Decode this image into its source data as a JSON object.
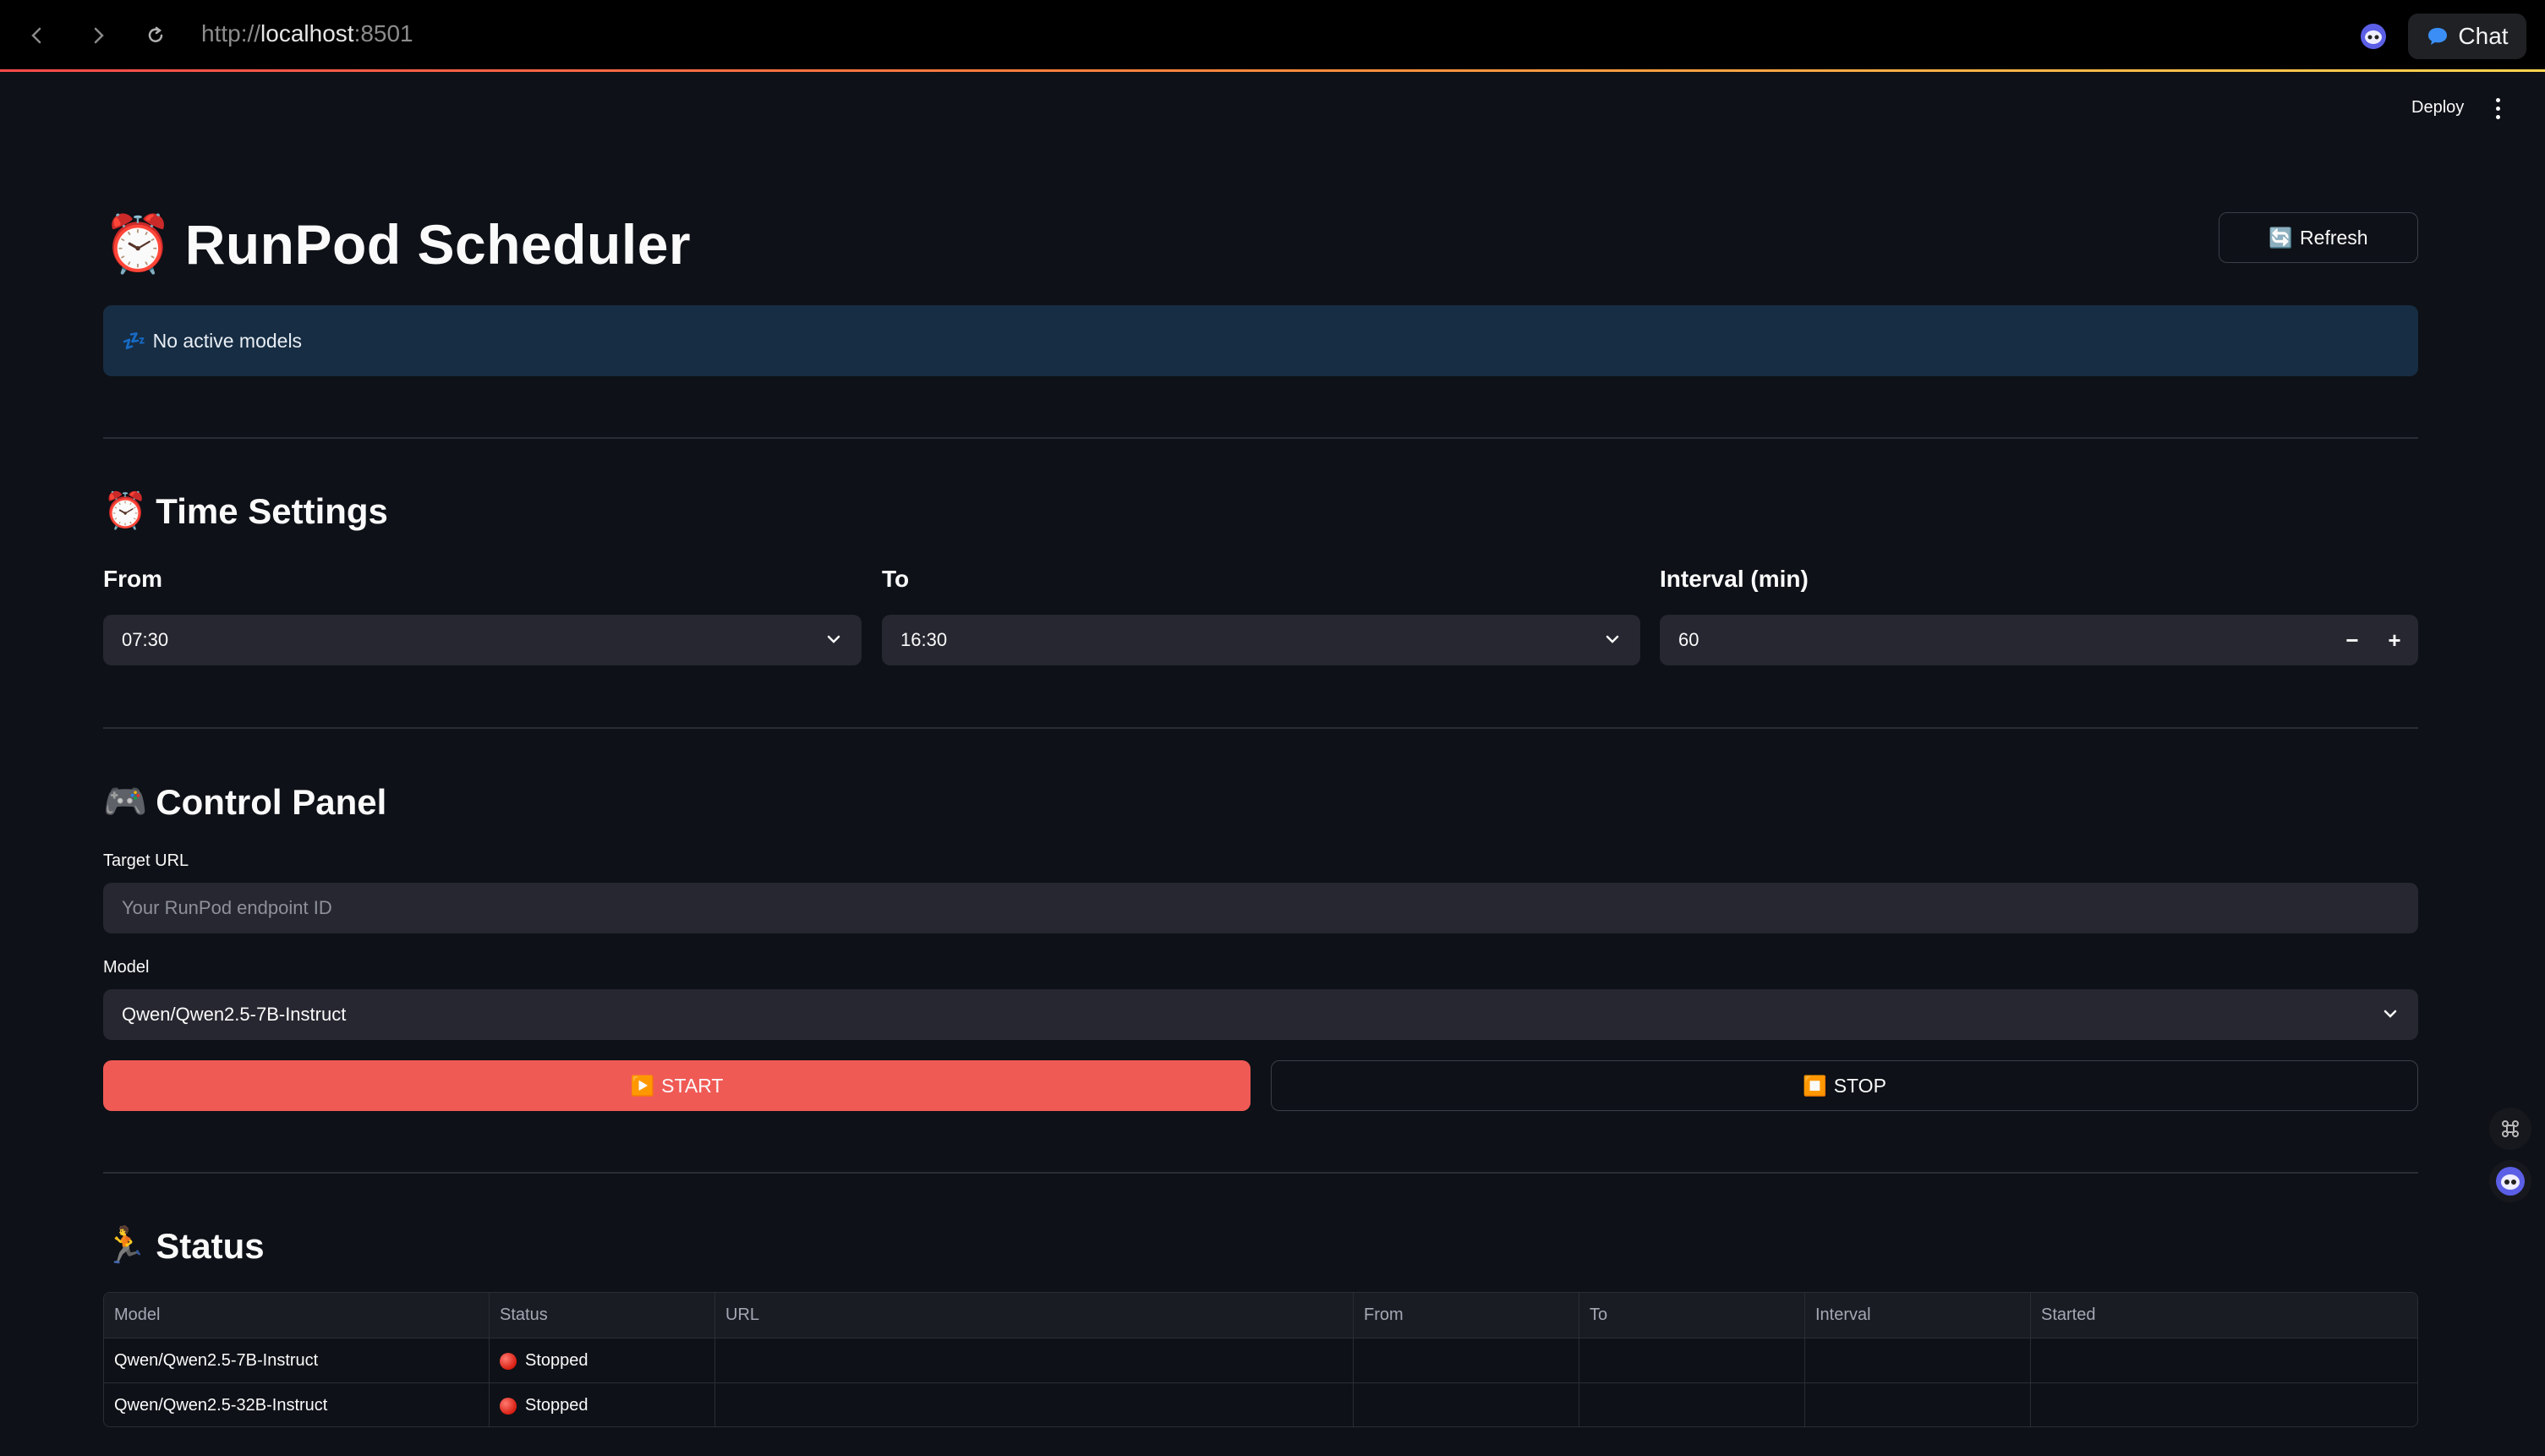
{
  "browser": {
    "url_scheme": "http://",
    "url_host": "localhost",
    "url_port": ":8501",
    "chat_label": "Chat"
  },
  "header": {
    "deploy_label": "Deploy"
  },
  "app": {
    "title": "RunPod Scheduler",
    "title_emoji": "⏰",
    "refresh_label": "Refresh",
    "refresh_emoji": "🔄",
    "info_message": "No active models",
    "info_emoji": "💤"
  },
  "time_settings": {
    "heading": "Time Settings",
    "heading_emoji": "⏰",
    "from_label": "From",
    "from_value": "07:30",
    "to_label": "To",
    "to_value": "16:30",
    "interval_label": "Interval (min)",
    "interval_value": "60",
    "minus": "−",
    "plus": "+"
  },
  "control_panel": {
    "heading": "Control Panel",
    "heading_emoji": "🎮",
    "target_url_label": "Target URL",
    "target_url_placeholder": "Your RunPod endpoint ID",
    "model_label": "Model",
    "model_value": "Qwen/Qwen2.5-7B-Instruct",
    "start_label": "START",
    "start_emoji": "▶️",
    "stop_label": "STOP",
    "stop_emoji": "⏹️"
  },
  "status": {
    "heading": "Status",
    "heading_emoji": "🏃",
    "columns": [
      "Model",
      "Status",
      "URL",
      "From",
      "To",
      "Interval",
      "Started"
    ],
    "rows": [
      {
        "model": "Qwen/Qwen2.5-7B-Instruct",
        "status": "Stopped",
        "url": "",
        "from": "",
        "to": "",
        "interval": "",
        "started": ""
      },
      {
        "model": "Qwen/Qwen2.5-32B-Instruct",
        "status": "Stopped",
        "url": "",
        "from": "",
        "to": "",
        "interval": "",
        "started": ""
      }
    ]
  },
  "colors": {
    "accent": "#f05a55",
    "info_bg": "#172d43",
    "status_stopped": "#d91e12"
  }
}
